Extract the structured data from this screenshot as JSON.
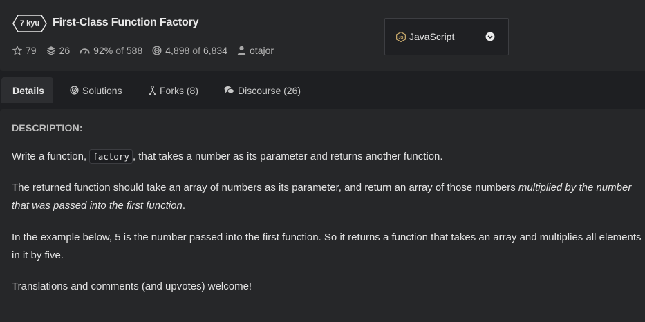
{
  "kata": {
    "rank": "7 kyu",
    "title": "First-Class Function Factory"
  },
  "stats": {
    "stars": "79",
    "collections": "26",
    "satisfaction": "92%",
    "satisfaction_of": "of",
    "satisfaction_total": "588",
    "completed": "4,898",
    "completed_of": "of",
    "completed_total": "6,834",
    "author": "otajor"
  },
  "language": {
    "selected": "JavaScript"
  },
  "tabs": [
    {
      "label": "Details"
    },
    {
      "label": "Solutions"
    },
    {
      "label": "Forks (8)"
    },
    {
      "label": "Discourse (26)"
    }
  ],
  "description": {
    "heading": "DESCRIPTION:",
    "p1_pre": "Write a function, ",
    "p1_code": "factory",
    "p1_post": ", that takes a number as its parameter and returns another function.",
    "p2_line1_pre": "The returned function should take an array of numbers as its parameter, and return an array of those numbers ",
    "p2_line1_em": "multiplied by the number",
    "p2_line2_em": "that was passed into the first function",
    "p2_line2_post": ".",
    "p3_line1": "In the example below, 5 is the number passed into the first function. So it returns a function that takes an array and multiplies all elements",
    "p3_line2": "in it by five.",
    "p4": "Translations and comments (and upvotes) welcome!"
  },
  "colors": {
    "background": "#1e1f22",
    "panel": "#262729",
    "node_icon": "#c8a96b"
  }
}
